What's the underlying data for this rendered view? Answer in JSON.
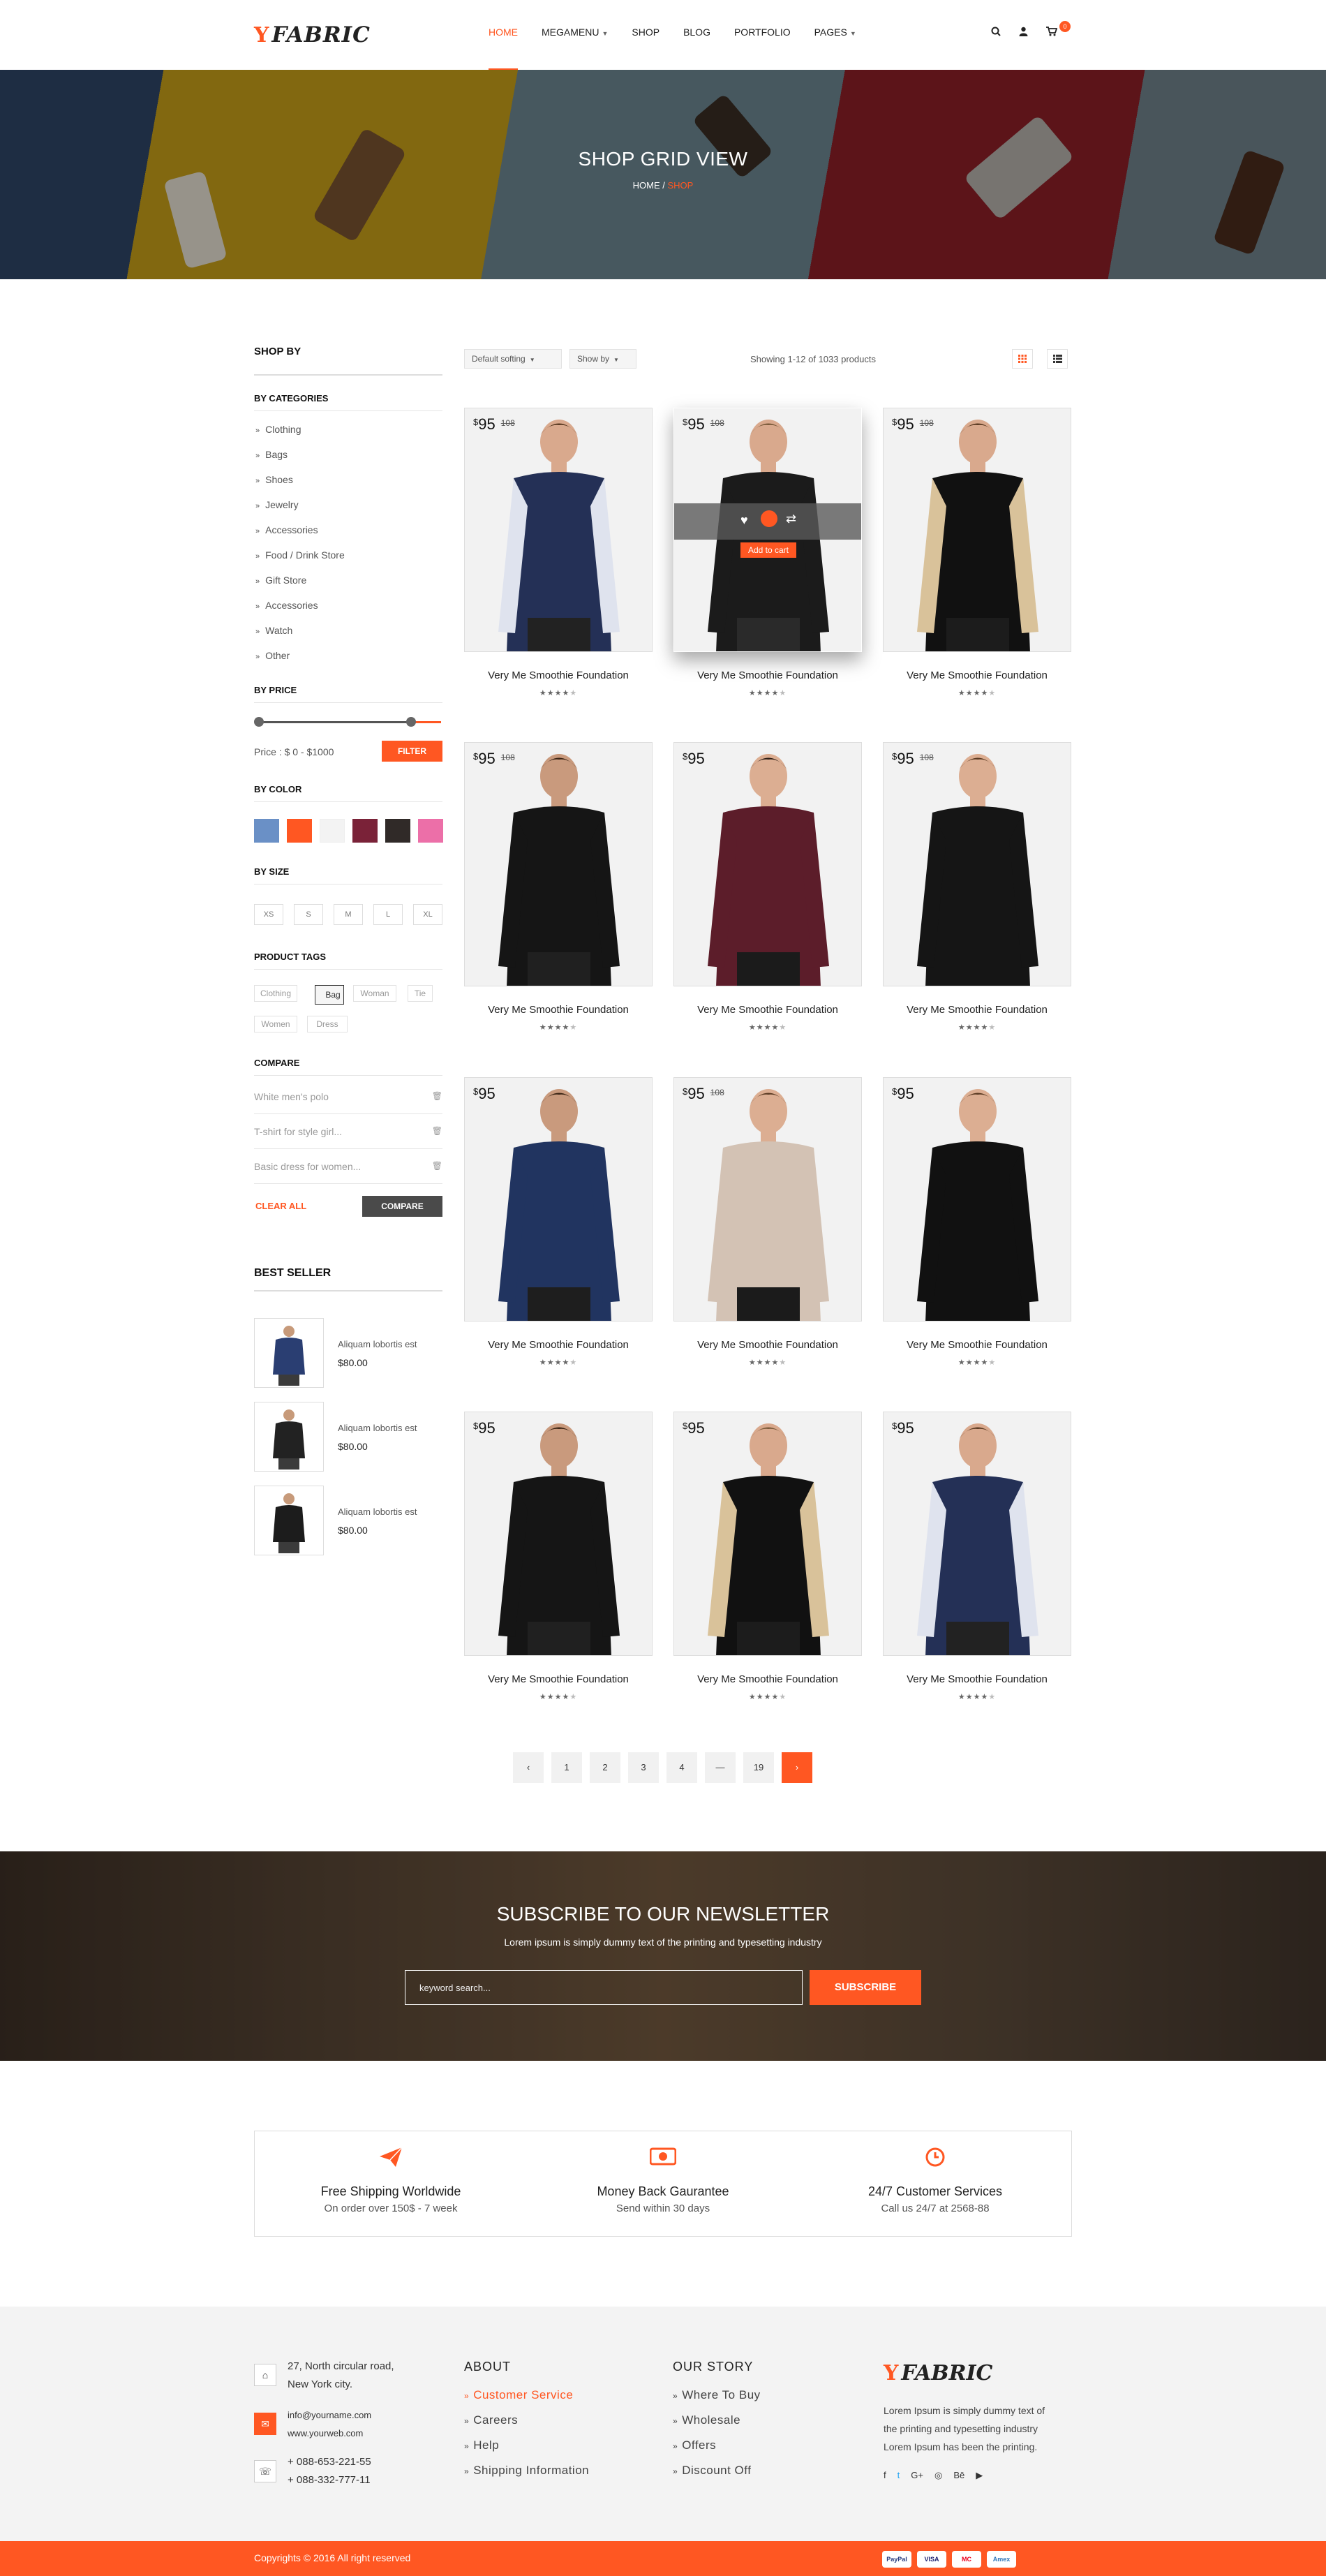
{
  "brand": {
    "logo_mark": "Y",
    "logo_text": "FABRIC"
  },
  "nav": [
    {
      "label": "HOME",
      "active": true
    },
    {
      "label": "MEGAMENU",
      "dropdown": true
    },
    {
      "label": "SHOP"
    },
    {
      "label": "BLOG"
    },
    {
      "label": "PORTFOLIO"
    },
    {
      "label": "PAGES",
      "dropdown": true
    }
  ],
  "cart": {
    "count": "0"
  },
  "hero": {
    "title": "SHOP GRID VIEW",
    "crumb_home": "HOME",
    "crumb_sep": " / ",
    "crumb_current": "SHOP"
  },
  "sidebar": {
    "shop_by": "SHOP BY",
    "categories_title": "BY CATEGORIES",
    "categories": [
      "Clothing",
      "Bags",
      "Shoes",
      "Jewelry",
      "Accessories",
      "Food / Drink Store",
      "Gift Store",
      "Accessories",
      "Watch",
      "Other"
    ],
    "price_title": "BY PRICE",
    "price_text": "Price : $ 0 - $1000",
    "filter_label": "FILTER",
    "price_range": {
      "min": 0,
      "max": 1000
    },
    "color_title": "BY COLOR",
    "colors": [
      "#6a90c6",
      "#ff5722",
      "#f3f3f3",
      "#7a2238",
      "#302a28",
      "#ec6fa8"
    ],
    "size_title": "BY SIZE",
    "sizes": [
      "XS",
      "S",
      "M",
      "L",
      "XL"
    ],
    "tags_title": "PRODUCT TAGS",
    "tags": [
      "Clothing",
      "Bag",
      "Woman",
      "Tie",
      "Women",
      "Dress"
    ],
    "compare_title": "COMPARE",
    "compare_items": [
      "White men's polo",
      "T-shirt for style girl...",
      "Basic dress for women..."
    ],
    "clear_all": "CLEAR ALL",
    "compare_btn": "COMPARE",
    "best_seller_title": "BEST SELLER",
    "best_sellers": [
      {
        "name": "Aliquam lobortis est",
        "price": "$80.00"
      },
      {
        "name": "Aliquam lobortis est",
        "price": "$80.00"
      },
      {
        "name": "Aliquam lobortis est",
        "price": "$80.00"
      }
    ]
  },
  "toolbar": {
    "sort": "Default softing",
    "show": "Show by",
    "count_text": "Showing 1-12 of 1033 products"
  },
  "products": [
    {
      "currency": "$",
      "price": "95",
      "old": "108",
      "name": "Very Me Smoothie Foundation",
      "rating": 4
    },
    {
      "currency": "$",
      "price": "95",
      "old": "108",
      "name": "Very Me Smoothie Foundation",
      "rating": 4,
      "hover": true,
      "add_to_cart": "Add to cart"
    },
    {
      "currency": "$",
      "price": "95",
      "old": "108",
      "name": "Very Me Smoothie Foundation",
      "rating": 4
    },
    {
      "currency": "$",
      "price": "95",
      "old": "108",
      "name": "Very Me Smoothie Foundation",
      "rating": 4
    },
    {
      "currency": "$",
      "price": "95",
      "old": "",
      "name": "Very Me Smoothie Foundation",
      "rating": 4
    },
    {
      "currency": "$",
      "price": "95",
      "old": "108",
      "name": "Very Me Smoothie Foundation",
      "rating": 4
    },
    {
      "currency": "$",
      "price": "95",
      "old": "",
      "name": "Very Me Smoothie Foundation",
      "rating": 4
    },
    {
      "currency": "$",
      "price": "95",
      "old": "108",
      "name": "Very Me Smoothie Foundation",
      "rating": 4
    },
    {
      "currency": "$",
      "price": "95",
      "old": "",
      "name": "Very Me Smoothie Foundation",
      "rating": 4
    },
    {
      "currency": "$",
      "price": "95",
      "old": "",
      "name": "Very Me Smoothie Foundation",
      "rating": 4
    },
    {
      "currency": "$",
      "price": "95",
      "old": "",
      "name": "Very Me Smoothie Foundation",
      "rating": 4
    },
    {
      "currency": "$",
      "price": "95",
      "old": "",
      "name": "Very Me Smoothie Foundation",
      "rating": 4
    }
  ],
  "pagination": [
    "‹",
    "1",
    "2",
    "3",
    "4",
    "—",
    "19",
    "›"
  ],
  "newsletter": {
    "title": "SUBSCRIBE TO OUR NEWSLETTER",
    "subtitle": "Lorem ipsum is simply dummy text of the printing and typesetting industry",
    "placeholder": "keyword search...",
    "button": "SUBSCRIBE"
  },
  "features": [
    {
      "icon": "paper-plane-icon",
      "title": "Free Shipping Worldwide",
      "sub": "On order over 150$ - 7 week"
    },
    {
      "icon": "money-icon",
      "title": "Money Back Gaurantee",
      "sub": "Send within 30 days"
    },
    {
      "icon": "clock-icon",
      "title": "24/7 Customer Services",
      "sub": "Call us 24/7 at 2568-88"
    }
  ],
  "footer": {
    "address": [
      "27, North circular road,",
      "New York city."
    ],
    "email": [
      "info@yourname.com",
      "www.yourweb.com"
    ],
    "phone": [
      "+ 088-653-221-55",
      "+ 088-332-777-11"
    ],
    "about_title": "ABOUT",
    "about_links": [
      "Customer Service",
      "Careers",
      "Help",
      "Shipping Information"
    ],
    "story_title": "OUR STORY",
    "story_links": [
      "Where To Buy",
      "Wholesale",
      "Offers",
      "Discount Off"
    ],
    "about_text": "Lorem Ipsum is simply dummy text of the printing and typesetting industry Lorem Ipsum has been the printing.",
    "social": [
      "f",
      "t",
      "G+",
      "◎",
      "Bē",
      "▶"
    ],
    "copyright": "Copyrights © 2016 All right reserved",
    "payments": [
      "PayPal",
      "VISA",
      "MC",
      "Amex"
    ]
  }
}
